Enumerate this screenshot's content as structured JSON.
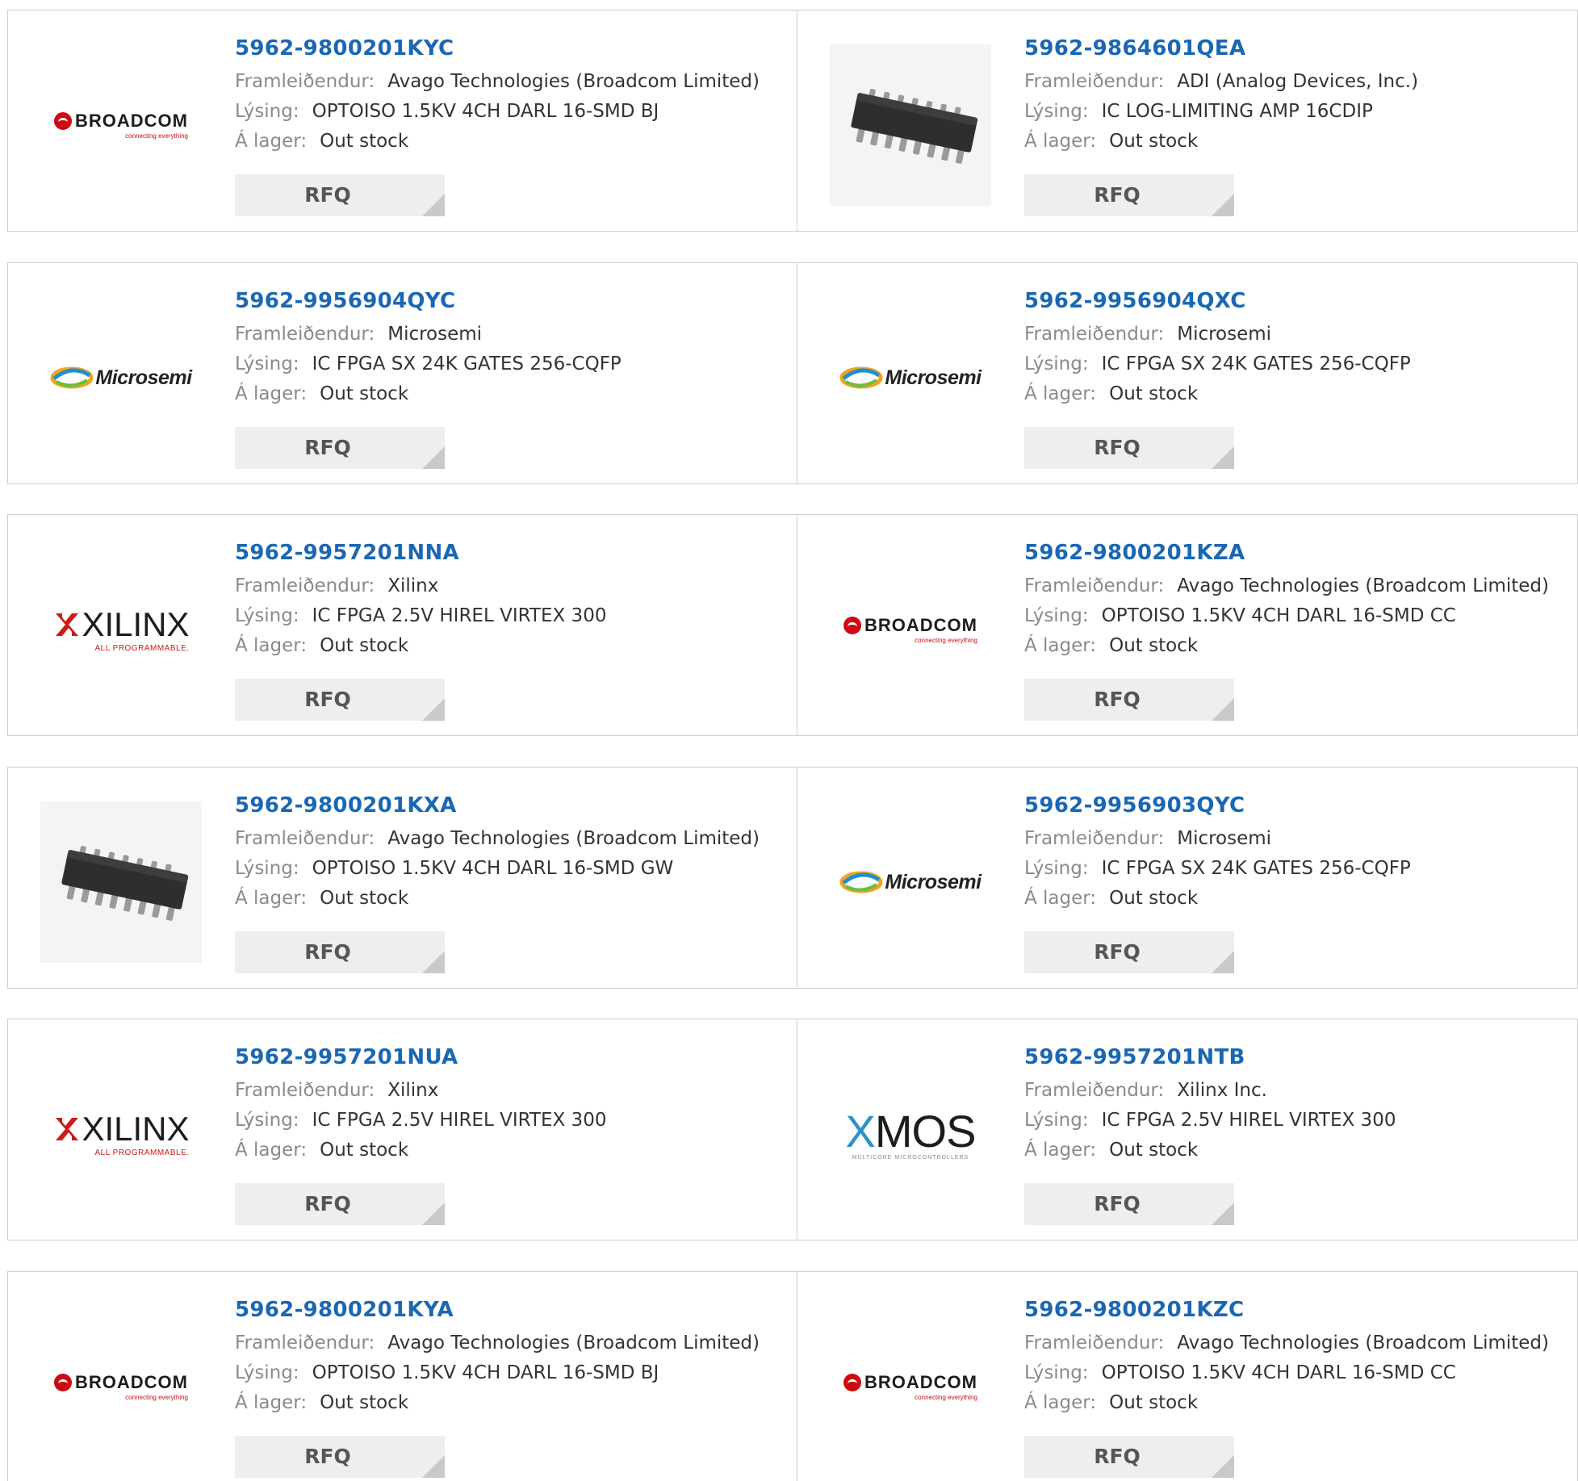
{
  "labels": {
    "manufacturer": "Framleiðendur:",
    "description": "Lýsing:",
    "stock": "Á lager:",
    "rfq": "RFQ"
  },
  "colors": {
    "part_link": "#1a67b4",
    "rfq_bg": "#eeeeee",
    "border": "#cfcfcf"
  },
  "products": [
    {
      "part": "5962-9800201KYC",
      "manufacturer": "Avago Technologies (Broadcom Limited)",
      "description": "OPTOISO 1.5KV 4CH DARL 16-SMD BJ",
      "stock": "Out stock",
      "image": "broadcom-logo"
    },
    {
      "part": "5962-9864601QEA",
      "manufacturer": "ADI (Analog Devices, Inc.)",
      "description": "IC LOG-LIMITING AMP 16CDIP",
      "stock": "Out stock",
      "image": "chip-photo"
    },
    {
      "part": "5962-9956904QYC",
      "manufacturer": "Microsemi",
      "description": "IC FPGA SX 24K GATES 256-CQFP",
      "stock": "Out stock",
      "image": "microsemi-logo"
    },
    {
      "part": "5962-9956904QXC",
      "manufacturer": "Microsemi",
      "description": "IC FPGA SX 24K GATES 256-CQFP",
      "stock": "Out stock",
      "image": "microsemi-logo"
    },
    {
      "part": "5962-9957201NNA",
      "manufacturer": "Xilinx",
      "description": "IC FPGA 2.5V HIREL VIRTEX 300",
      "stock": "Out stock",
      "image": "xilinx-logo"
    },
    {
      "part": "5962-9800201KZA",
      "manufacturer": "Avago Technologies (Broadcom Limited)",
      "description": "OPTOISO 1.5KV 4CH DARL 16-SMD CC",
      "stock": "Out stock",
      "image": "broadcom-logo"
    },
    {
      "part": "5962-9800201KXA",
      "manufacturer": "Avago Technologies (Broadcom Limited)",
      "description": "OPTOISO 1.5KV 4CH DARL 16-SMD GW",
      "stock": "Out stock",
      "image": "chip-photo"
    },
    {
      "part": "5962-9956903QYC",
      "manufacturer": "Microsemi",
      "description": "IC FPGA SX 24K GATES 256-CQFP",
      "stock": "Out stock",
      "image": "microsemi-logo"
    },
    {
      "part": "5962-9957201NUA",
      "manufacturer": "Xilinx",
      "description": "IC FPGA 2.5V HIREL VIRTEX 300",
      "stock": "Out stock",
      "image": "xilinx-logo"
    },
    {
      "part": "5962-9957201NTB",
      "manufacturer": "Xilinx Inc.",
      "description": "IC FPGA 2.5V HIREL VIRTEX 300",
      "stock": "Out stock",
      "image": "xmos-logo"
    },
    {
      "part": "5962-9800201KYA",
      "manufacturer": "Avago Technologies (Broadcom Limited)",
      "description": "OPTOISO 1.5KV 4CH DARL 16-SMD BJ",
      "stock": "Out stock",
      "image": "broadcom-logo"
    },
    {
      "part": "5962-9800201KZC",
      "manufacturer": "Avago Technologies (Broadcom Limited)",
      "description": "OPTOISO 1.5KV 4CH DARL 16-SMD CC",
      "stock": "Out stock",
      "image": "broadcom-logo"
    }
  ],
  "logos": {
    "broadcom": {
      "text": "BROADCOM",
      "tagline": "connecting everything"
    },
    "microsemi": {
      "text": "Microsemi"
    },
    "xilinx": {
      "text": "XILINX",
      "tagline": "ALL PROGRAMMABLE."
    },
    "xmos": {
      "x": "X",
      "text": "MOS",
      "tagline": "MULTICORE MICROCONTROLLERS"
    }
  }
}
